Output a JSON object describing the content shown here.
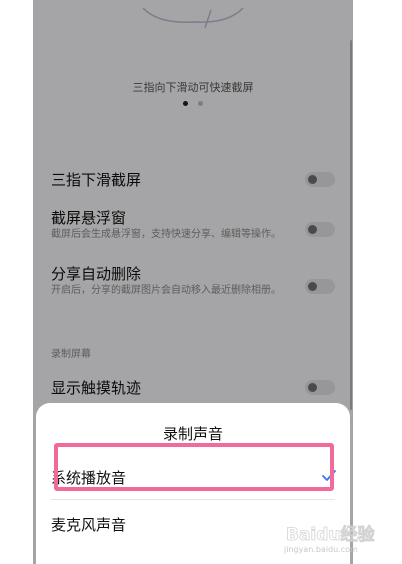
{
  "screen": {
    "gesture_hint": "三指向下滑动可快速截屏",
    "pager": {
      "total": 2,
      "active": 1
    }
  },
  "settings": [
    {
      "title": "三指下滑截屏",
      "desc": "",
      "enabled": false
    },
    {
      "title": "截屏悬浮窗",
      "desc": "截屏后会生成悬浮窗，支持快速分享、编辑等操作。",
      "enabled": false
    },
    {
      "title": "分享自动删除",
      "desc": "开启后，分享的截屏图片会自动移入最近删除相册。",
      "enabled": false
    }
  ],
  "section_record": {
    "header": "录制屏幕",
    "items": [
      {
        "title": "显示触摸轨迹",
        "enabled": false
      }
    ]
  },
  "sound_sheet": {
    "title": "录制声音",
    "options": [
      {
        "label": "系统播放音",
        "selected": true
      },
      {
        "label": "麦克风声音",
        "selected": false
      }
    ]
  },
  "watermark": {
    "brand": "Baidu经验",
    "url": "jingyan.baidu.com"
  },
  "colors": {
    "accent_check": "#3478f6",
    "highlight_box": "#f06a9b"
  }
}
